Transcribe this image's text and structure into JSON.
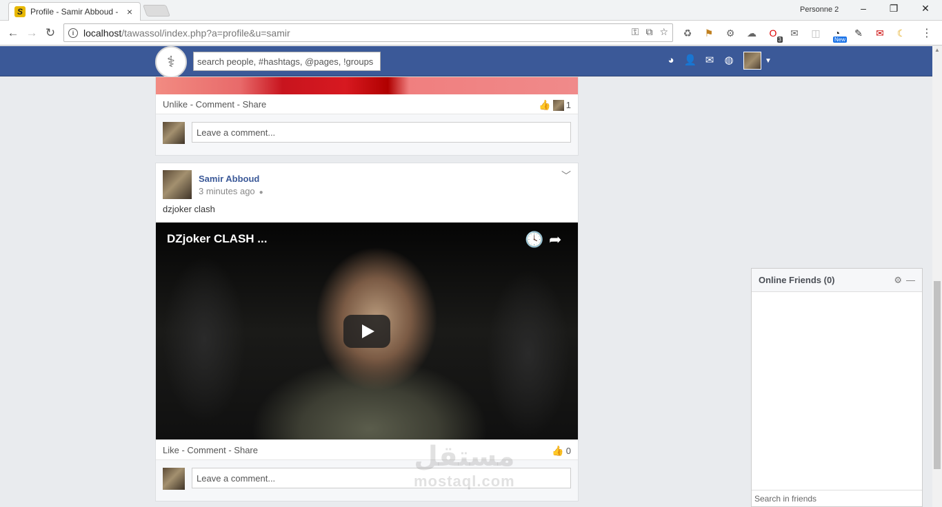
{
  "browser": {
    "tab_title": "Profile - Samir Abboud -",
    "tab_close": "×",
    "profile_name": "Personne 2",
    "url_host": "localhost",
    "url_path": "/tawassol/index.php?a=profile&u=samir",
    "ext_badge_count": "3",
    "ext_badge_new": "New"
  },
  "site": {
    "search_placeholder": "search people, #hashtags, @pages, !groups"
  },
  "post1": {
    "actions": "Unlike - Comment - Share",
    "like_count": "1",
    "comment_placeholder": "Leave a comment..."
  },
  "post2": {
    "author": "Samir Abboud",
    "time": "3 minutes ago",
    "text": "dzjoker clash",
    "video_title": "DZjoker CLASH ...",
    "actions": "Like - Comment - Share",
    "like_count": "0",
    "comment_placeholder": "Leave a comment..."
  },
  "friends": {
    "title": "Online Friends (0)",
    "search_placeholder": "Search in friends"
  },
  "watermark": {
    "arabic": "مستقل",
    "latin": "mostaql.com"
  },
  "colors": {
    "brand": "#3b5998",
    "page_bg": "#e9ebee"
  }
}
